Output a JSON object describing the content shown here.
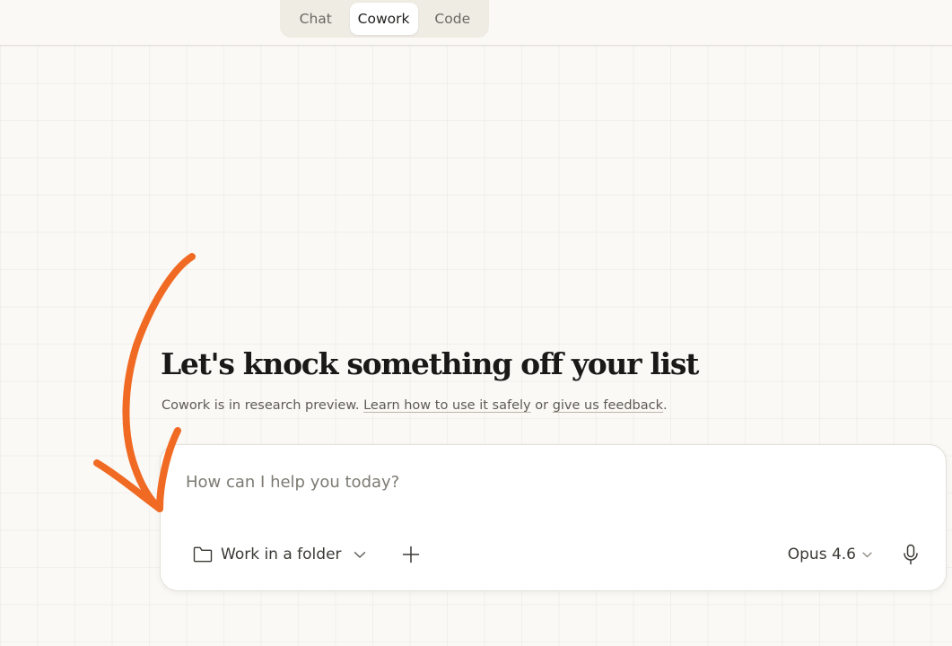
{
  "mode_tabs": {
    "items": [
      {
        "label": "Chat"
      },
      {
        "label": "Cowork"
      },
      {
        "label": "Code"
      }
    ],
    "active": "Cowork"
  },
  "hero": {
    "title": "Let's knock something off your list",
    "subtitle_prefix": "Cowork is in research preview.",
    "learn_link": "Learn how to use it safely",
    "subtitle_or": "or",
    "feedback_link": "give us feedback",
    "subtitle_suffix": "."
  },
  "composer": {
    "placeholder": "How can I help you today?",
    "value": "",
    "folder_label": "Work in a folder",
    "model_label": "Opus 4.6"
  },
  "icons": {
    "folder": "folder-icon",
    "chevron": "chevron-down-icon",
    "plus": "plus-icon",
    "mic": "microphone-icon"
  },
  "colors": {
    "background": "#faf9f5",
    "annotation_arrow": "#f06a24",
    "card": "#ffffff"
  }
}
